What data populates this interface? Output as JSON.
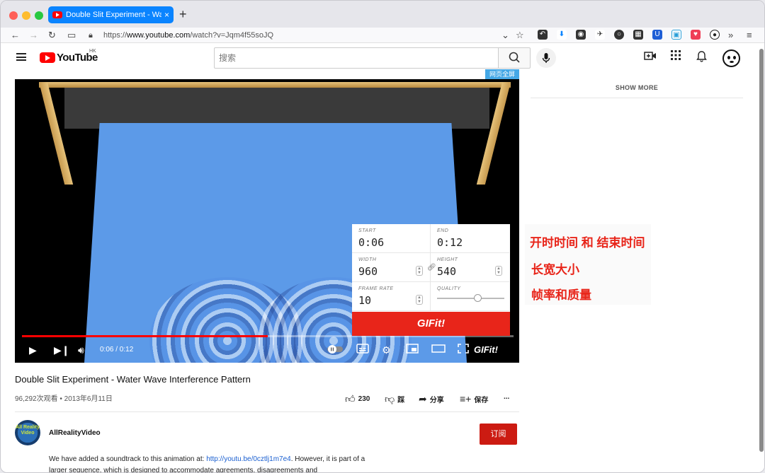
{
  "browser": {
    "tab_title": "Double Slit Experiment - Water W",
    "tab_close": "×",
    "new_tab": "+",
    "url_scheme": "https://",
    "url_host": "www.youtube.com",
    "url_path": "/watch?v=Jqm4f55soJQ"
  },
  "youtube": {
    "logo_text": "YouTube",
    "region": "HK",
    "search_placeholder": "搜索",
    "fullscreen_tag": "网页全屏",
    "show_more": "SHOW MORE"
  },
  "player": {
    "current_time": "0:06",
    "duration": "0:12",
    "time_display": "0:06 / 0:12",
    "progress": 0.5,
    "gifit_logo": "GIFit!"
  },
  "gifit": {
    "start_label": "START",
    "start_value": "0:06",
    "end_label": "END",
    "end_value": "0:12",
    "width_label": "WIDTH",
    "width_value": "960",
    "height_label": "HEIGHT",
    "height_value": "540",
    "framerate_label": "FRAME RATE",
    "framerate_value": "10",
    "quality_label": "QUALITY",
    "quality_level": 0.6,
    "button_label": "GIFit!"
  },
  "annotations": {
    "a1": "开时时间 和 结束时间",
    "a2": "长宽大小",
    "a3": "帧率和质量"
  },
  "video": {
    "title": "Double Slit Experiment - Water Wave Interference Pattern",
    "views_date": "96,292次观看 • 2013年6月11日",
    "likes": "230",
    "dislike_label": "踩",
    "share_label": "分享",
    "save_label": "保存",
    "more_label": "..."
  },
  "channel": {
    "avatar_text": "All Reality Video",
    "name": "AllRealityVideo",
    "subscribe_label": "订阅"
  },
  "description": {
    "text_1": "We have added a soundtrack to this animation at: ",
    "link": "http://youtu.be/0cztlj1m7e4",
    "text_2": ". However, it is part of a larger sequence, which is designed to accommodate agreements, disagreements and"
  },
  "colors": {
    "accent": "#0a84ff",
    "youtube_red": "#ff0000",
    "gifit_red": "#e8251a",
    "subscribe_red": "#cc1b12"
  }
}
